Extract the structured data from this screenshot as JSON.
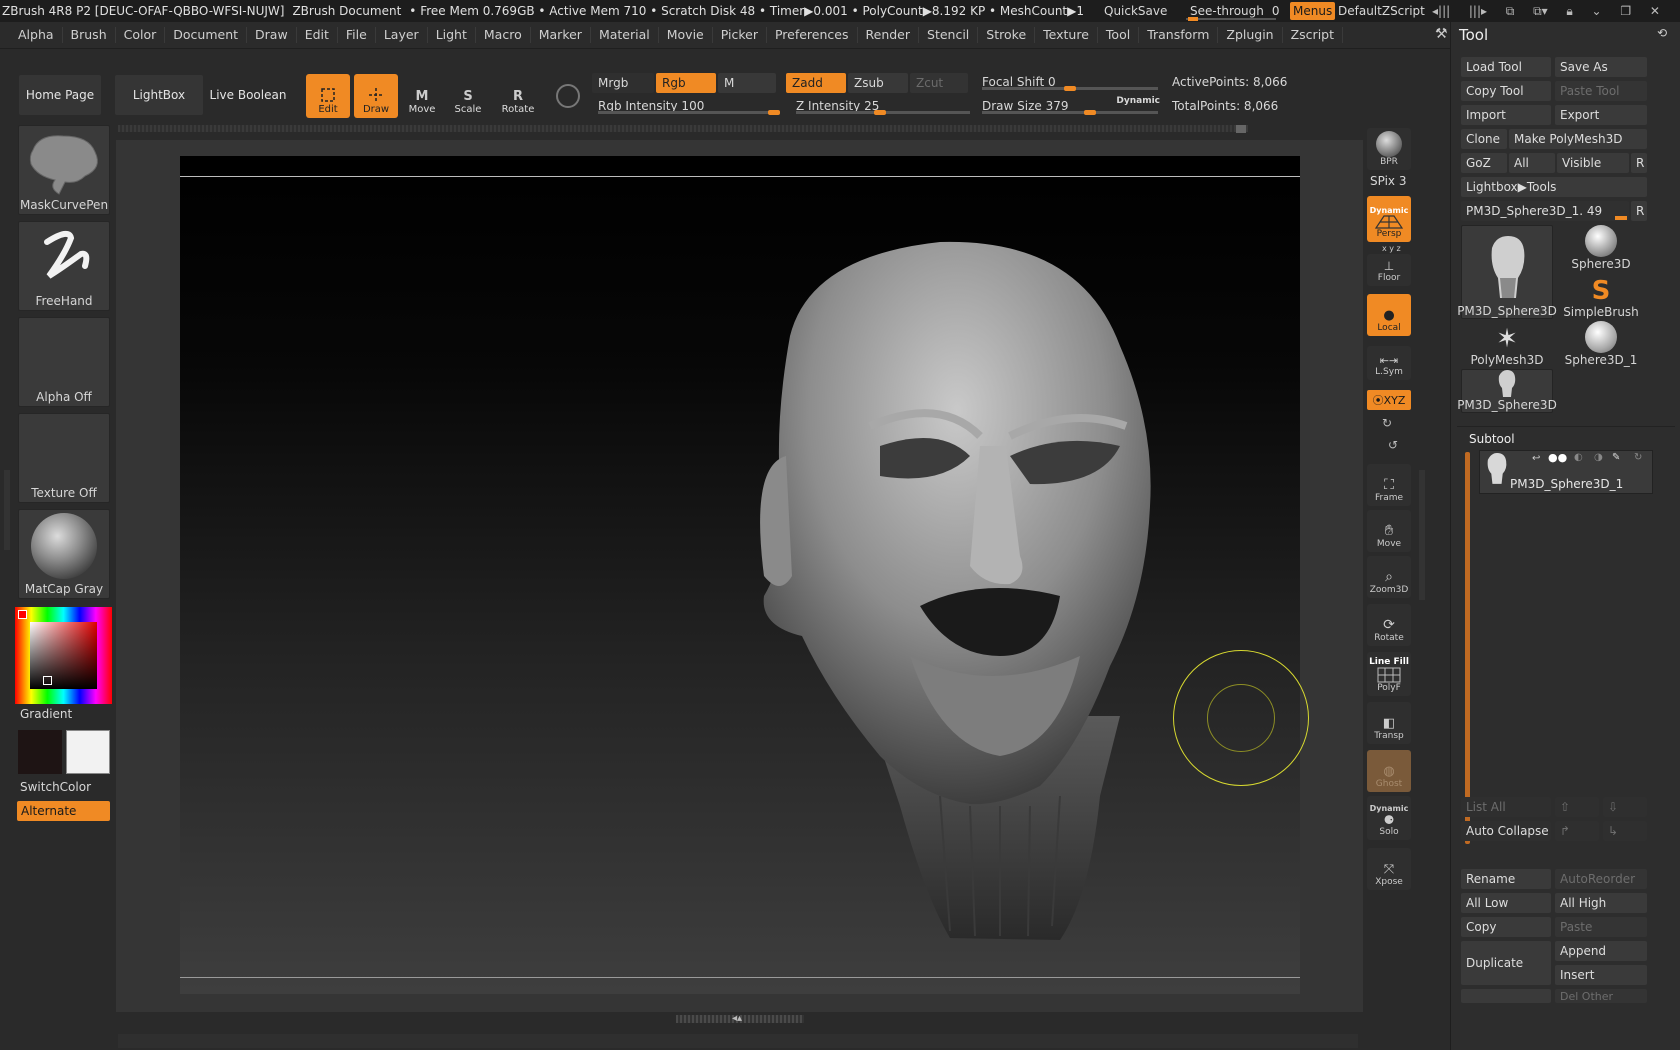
{
  "titlebar": {
    "app": "ZBrush 4R8 P2 [DEUC-OFAF-QBBO-WFSI-NUJW]",
    "document": "ZBrush Document",
    "stats": "• Free Mem 0.769GB • Active Mem 710 • Scratch Disk 48 •  Timer▶0.001 • PolyCount▶8.192 KP  • MeshCount▶1",
    "quicksave": "QuickSave",
    "seethrough_label": "See-through",
    "seethrough_value": "0",
    "menus": "Menus",
    "script": "DefaultZScript"
  },
  "menubar": [
    "Alpha",
    "Brush",
    "Color",
    "Document",
    "Draw",
    "Edit",
    "File",
    "Layer",
    "Light",
    "Macro",
    "Marker",
    "Material",
    "Movie",
    "Picker",
    "Preferences",
    "Render",
    "Stencil",
    "Stroke",
    "Texture",
    "Tool",
    "Transform",
    "Zplugin",
    "Zscript"
  ],
  "shelf": {
    "home": "Home Page",
    "lightbox": "LightBox",
    "live_boolean": "Live Boolean",
    "edit": "Edit",
    "draw": "Draw",
    "move": "Move",
    "scale": "Scale",
    "rotate": "Rotate",
    "mrgb": "Mrgb",
    "rgb": "Rgb",
    "m": "M",
    "zadd": "Zadd",
    "zsub": "Zsub",
    "zcut": "Zcut",
    "rgb_intensity": "Rgb Intensity 100",
    "z_intensity": "Z Intensity 25",
    "focal_shift": "Focal Shift 0",
    "draw_size": "Draw Size 379",
    "dynamic": "Dynamic",
    "active_points": "ActivePoints: 8,066",
    "total_points": "TotalPoints: 8,066"
  },
  "left": {
    "brush": "MaskCurvePen",
    "stroke": "FreeHand",
    "alpha": "Alpha Off",
    "texture": "Texture Off",
    "material": "MatCap Gray",
    "gradient": "Gradient",
    "switchcolor": "SwitchColor",
    "alternate": "Alternate",
    "main_color": "#1e1414",
    "secondary_color": "#f2f2f2"
  },
  "rightbar": {
    "bpr": "BPR",
    "spix": "SPix 3",
    "dynamic": "Dynamic",
    "persp": "Persp",
    "xyz_small": "x y z",
    "floor": "Floor",
    "local": "Local",
    "lsym": "L.Sym",
    "xyz": "⦿XYZ",
    "frame": "Frame",
    "move": "Move",
    "zoom3d": "Zoom3D",
    "rotate": "Rotate",
    "linefill": "Line Fill",
    "polyf": "PolyF",
    "transp": "Transp",
    "ghost": "Ghost",
    "dynamic2": "Dynamic",
    "solo": "Solo",
    "xpose": "Xpose"
  },
  "tool": {
    "title": "Tool",
    "load_tool": "Load Tool",
    "save_as": "Save As",
    "copy_tool": "Copy Tool",
    "paste_tool": "Paste Tool",
    "import": "Import",
    "export": "Export",
    "clone": "Clone",
    "make_polymesh": "Make PolyMesh3D",
    "goz": "GoZ",
    "all": "All",
    "visible": "Visible",
    "r": "R",
    "lightbox_tools": "Lightbox▶Tools",
    "current_tool": "PM3D_Sphere3D_1. 49",
    "thumbs": [
      "PM3D_Sphere3D",
      "Sphere3D",
      "SimpleBrush",
      "PolyMesh3D",
      "Sphere3D_1",
      "PM3D_Sphere3D"
    ],
    "subtool_header": "Subtool",
    "subtool_name": "PM3D_Sphere3D_1",
    "list_all": "List All",
    "auto_collapse": "Auto Collapse",
    "rename": "Rename",
    "autoreorder": "AutoReorder",
    "all_low": "All Low",
    "all_high": "All High",
    "copy": "Copy",
    "paste": "Paste",
    "duplicate": "Duplicate",
    "append": "Append",
    "insert": "Insert",
    "del_other": "Del Other"
  },
  "colors": {
    "accent": "#f08a24",
    "brush_cursor": "#d7d930"
  }
}
